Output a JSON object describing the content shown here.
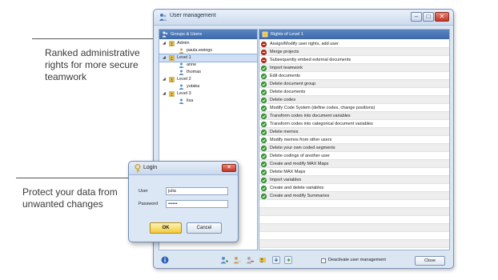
{
  "callouts": {
    "top": "Ranked administrative rights for more secure teamwork",
    "bottom": "Protect your data from unwanted changes"
  },
  "window": {
    "title": "User management",
    "controls": [
      "minimize",
      "maximize",
      "close"
    ]
  },
  "left_pane": {
    "header": "Groups & Users",
    "tree": [
      {
        "label": "Admin",
        "type": "group",
        "level": 0,
        "expanded": true
      },
      {
        "label": "paula.ewings",
        "type": "user",
        "level": 1
      },
      {
        "label": "Level 1",
        "type": "group",
        "level": 0,
        "expanded": true,
        "selected": true
      },
      {
        "label": "anne",
        "type": "user",
        "level": 1
      },
      {
        "label": "thomas",
        "type": "user",
        "level": 1
      },
      {
        "label": "Level 2",
        "type": "group",
        "level": 0,
        "expanded": true
      },
      {
        "label": "yutaka",
        "type": "user",
        "level": 1
      },
      {
        "label": "Level 3",
        "type": "group",
        "level": 0,
        "expanded": true
      },
      {
        "label": "lisa",
        "type": "user",
        "level": 1
      }
    ]
  },
  "right_pane": {
    "header": "Rights of Level 1",
    "rights": [
      {
        "label": "Assign/Modify user rights, add user",
        "allowed": false
      },
      {
        "label": "Merge projects",
        "allowed": false
      },
      {
        "label": "Subsequently embed external documents",
        "allowed": false
      },
      {
        "label": "Import teamwork",
        "allowed": true
      },
      {
        "label": "Edit documents",
        "allowed": true
      },
      {
        "label": "Delete document group",
        "allowed": true
      },
      {
        "label": "Delete documents",
        "allowed": true
      },
      {
        "label": "Delete codes",
        "allowed": true
      },
      {
        "label": "Modify Code System (define codes, change positions)",
        "allowed": true
      },
      {
        "label": "Transform codes into document variables",
        "allowed": true
      },
      {
        "label": "Transform codes into categorical document variables",
        "allowed": true
      },
      {
        "label": "Delete memos",
        "allowed": true
      },
      {
        "label": "Modify memos from other users",
        "allowed": true
      },
      {
        "label": "Delete your own coded segments",
        "allowed": true
      },
      {
        "label": "Delete codings of another user",
        "allowed": true
      },
      {
        "label": "Create and modify MAX Maps",
        "allowed": true
      },
      {
        "label": "Delete MAX Maps",
        "allowed": true
      },
      {
        "label": "Import variables",
        "allowed": true
      },
      {
        "label": "Create and delete variables",
        "allowed": true
      },
      {
        "label": "Create and modify Summaries",
        "allowed": true
      }
    ],
    "empty_rows": 7
  },
  "bottom_bar": {
    "toolbar_icons": [
      "info-icon",
      "add-user-icon",
      "edit-user-icon",
      "delete-user-icon",
      "add-group-icon",
      "import-icon",
      "export-icon"
    ],
    "deactivate_label": "Deactivate user management",
    "deactivate_checked": false,
    "close_label": "Close"
  },
  "login": {
    "title": "Login",
    "user_label": "User",
    "user_value": "julia",
    "password_label": "Password",
    "password_value": "••••••",
    "ok_label": "OK",
    "cancel_label": "Cancel"
  },
  "colors": {
    "allowed": "#3aa33a",
    "denied": "#cf2b1f",
    "header_blue": "#3d69a8",
    "window_bg": "#dbe6f3"
  }
}
